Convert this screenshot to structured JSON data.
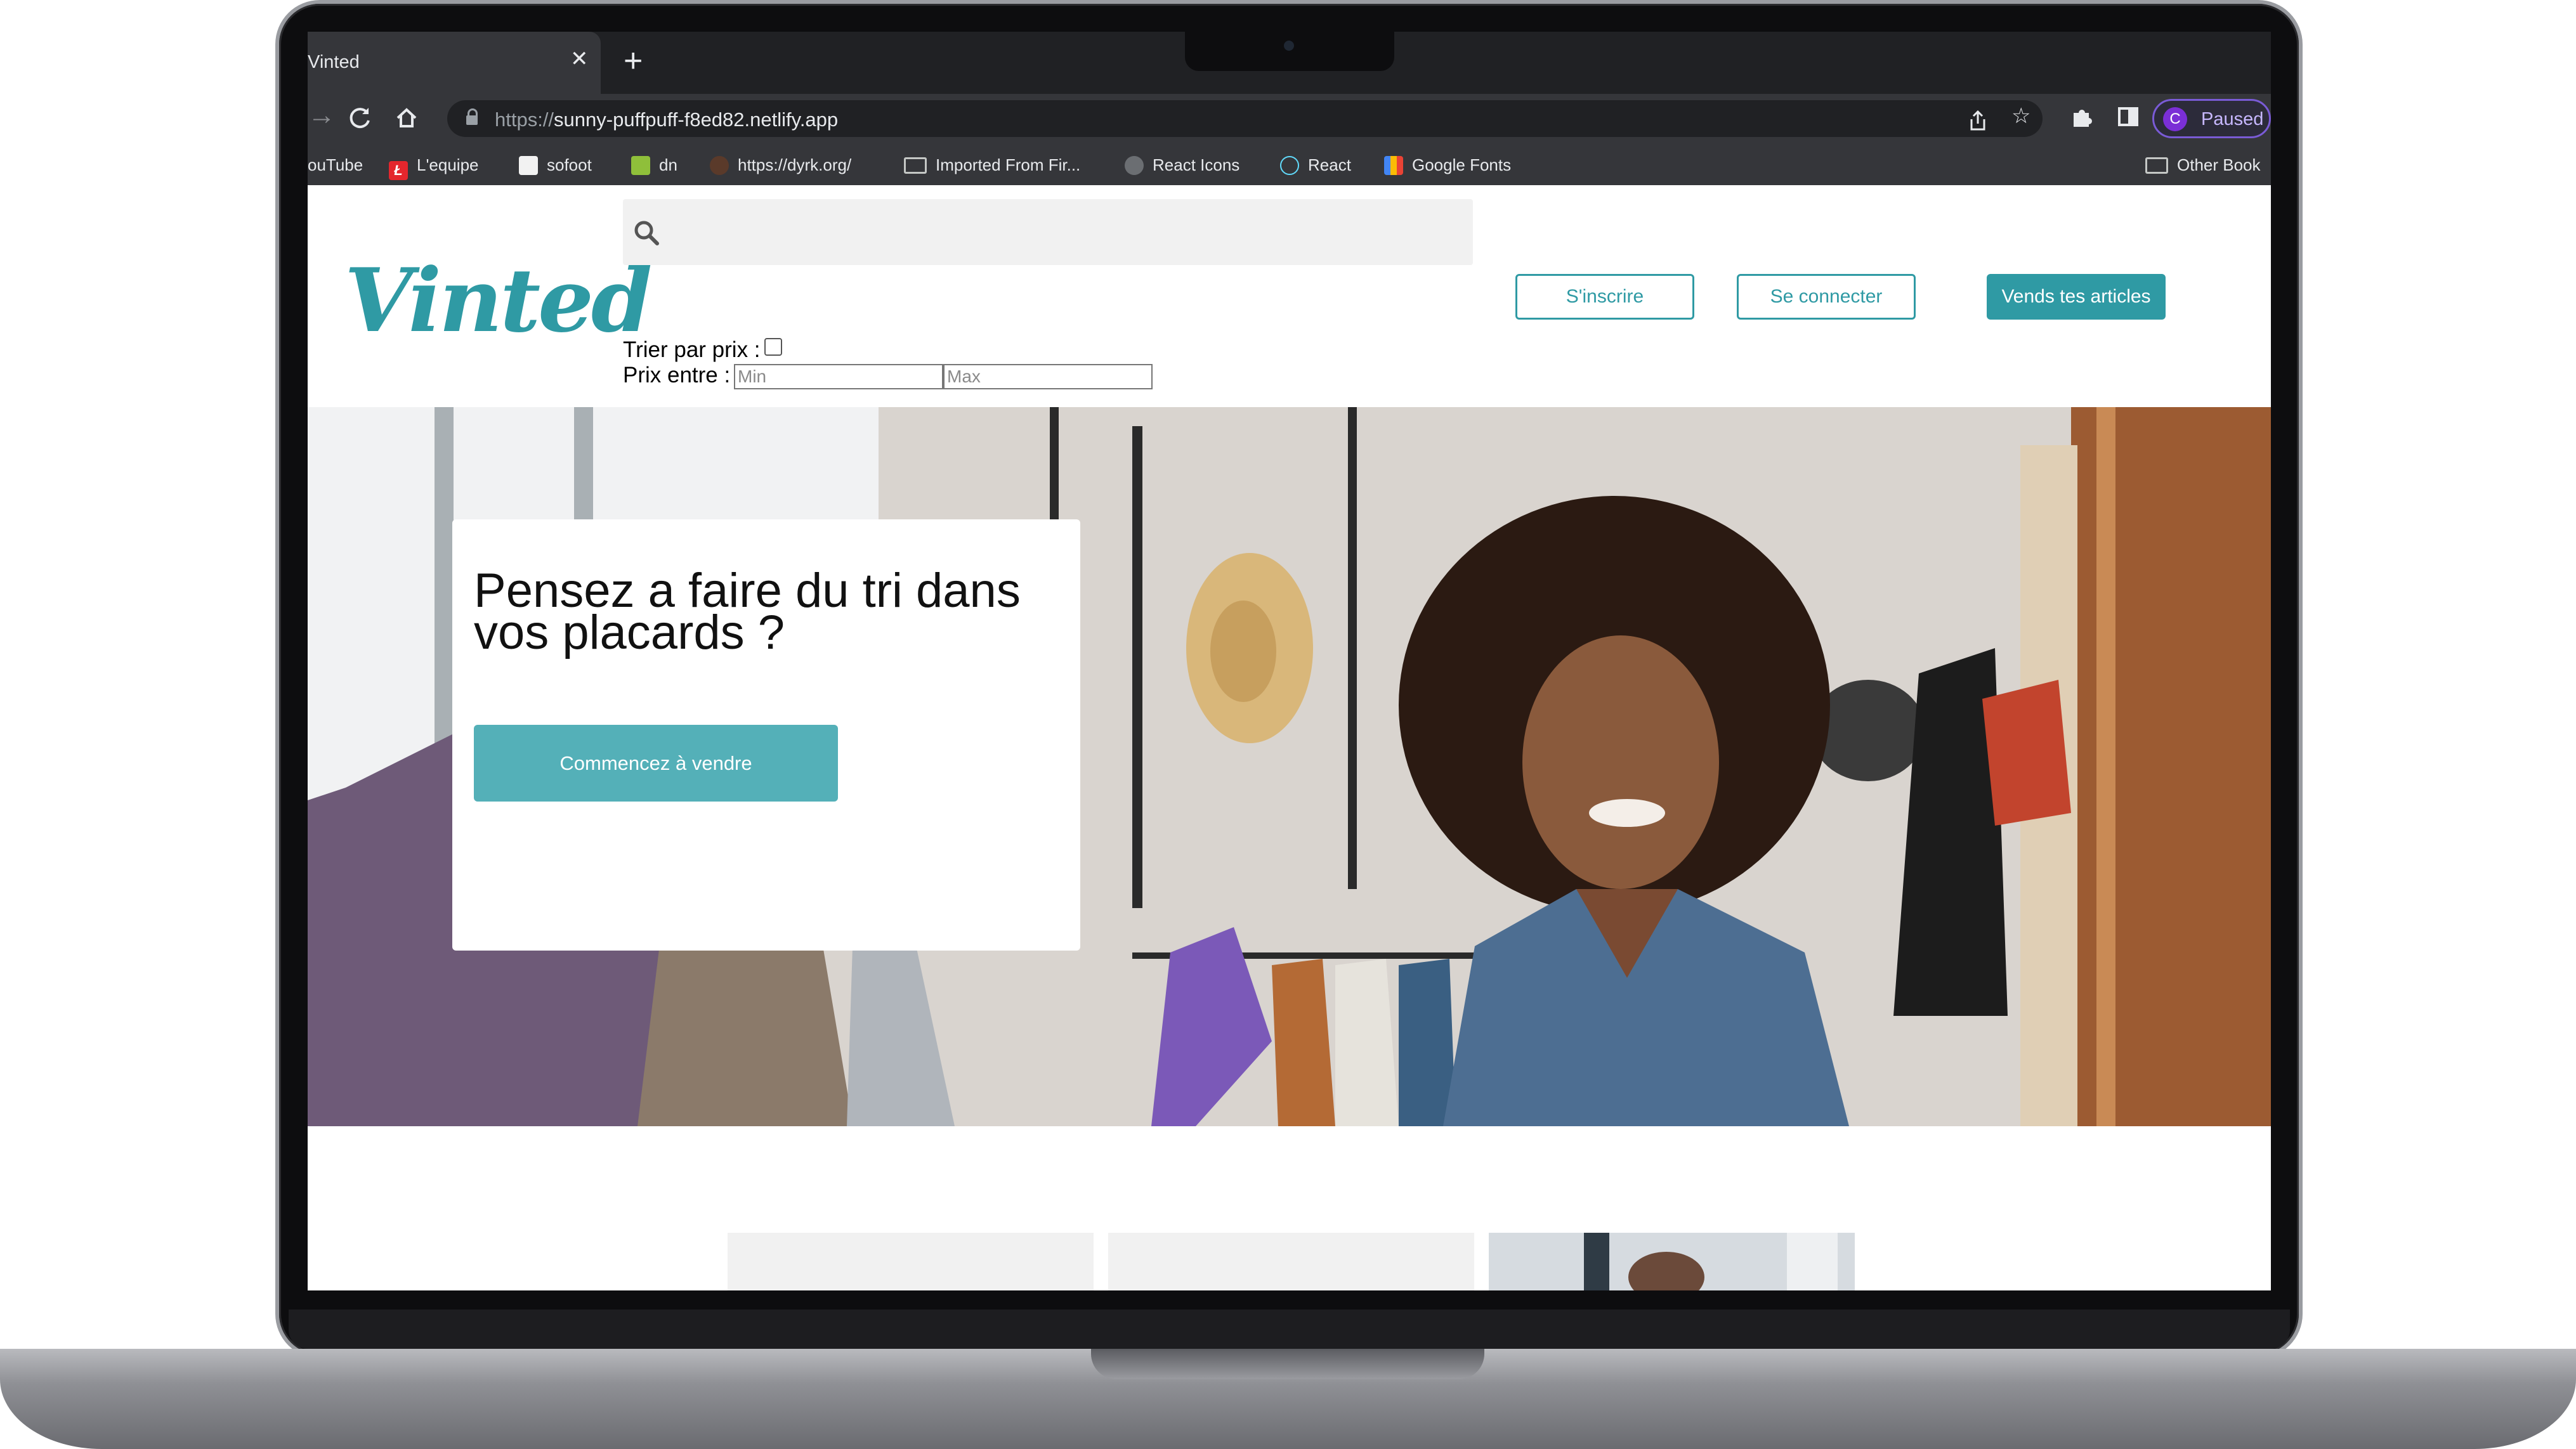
{
  "browser": {
    "tab_title": "Vinted",
    "tab_close": "✕",
    "new_tab": "+",
    "url_scheme": "https://",
    "url_host": "sunny-puffpuff-f8ed82.netlify.app",
    "profile_initial": "C",
    "profile_status": "Paused",
    "bookmarks": [
      {
        "label": "ouTube",
        "icon": "youtube-icon"
      },
      {
        "label": "L'equipe",
        "icon": "lequipe-icon"
      },
      {
        "label": "sofoot",
        "icon": "sofoot-icon"
      },
      {
        "label": "dn",
        "icon": "dn-icon"
      },
      {
        "label": "https://dyrk.org/",
        "icon": "dyrk-icon"
      },
      {
        "label": "Imported From Fir...",
        "icon": "folder-icon"
      },
      {
        "label": "React Icons",
        "icon": "react-icons-icon"
      },
      {
        "label": "React",
        "icon": "react-icon"
      },
      {
        "label": "Google Fonts",
        "icon": "google-fonts-icon"
      },
      {
        "label": "Other Book",
        "icon": "folder-icon"
      }
    ]
  },
  "site": {
    "logo": "Vinted",
    "signup_label": "S'inscrire",
    "login_label": "Se connecter",
    "sell_label": "Vends tes articles",
    "sort_label": "Trier par prix :",
    "price_label": "Prix entre :",
    "min_placeholder": "Min",
    "max_placeholder": "Max",
    "accent": "#2f9aa4"
  },
  "hero": {
    "title": "Pensez a faire du tri dans vos placards ?",
    "cta_label": "Commencez à vendre"
  }
}
